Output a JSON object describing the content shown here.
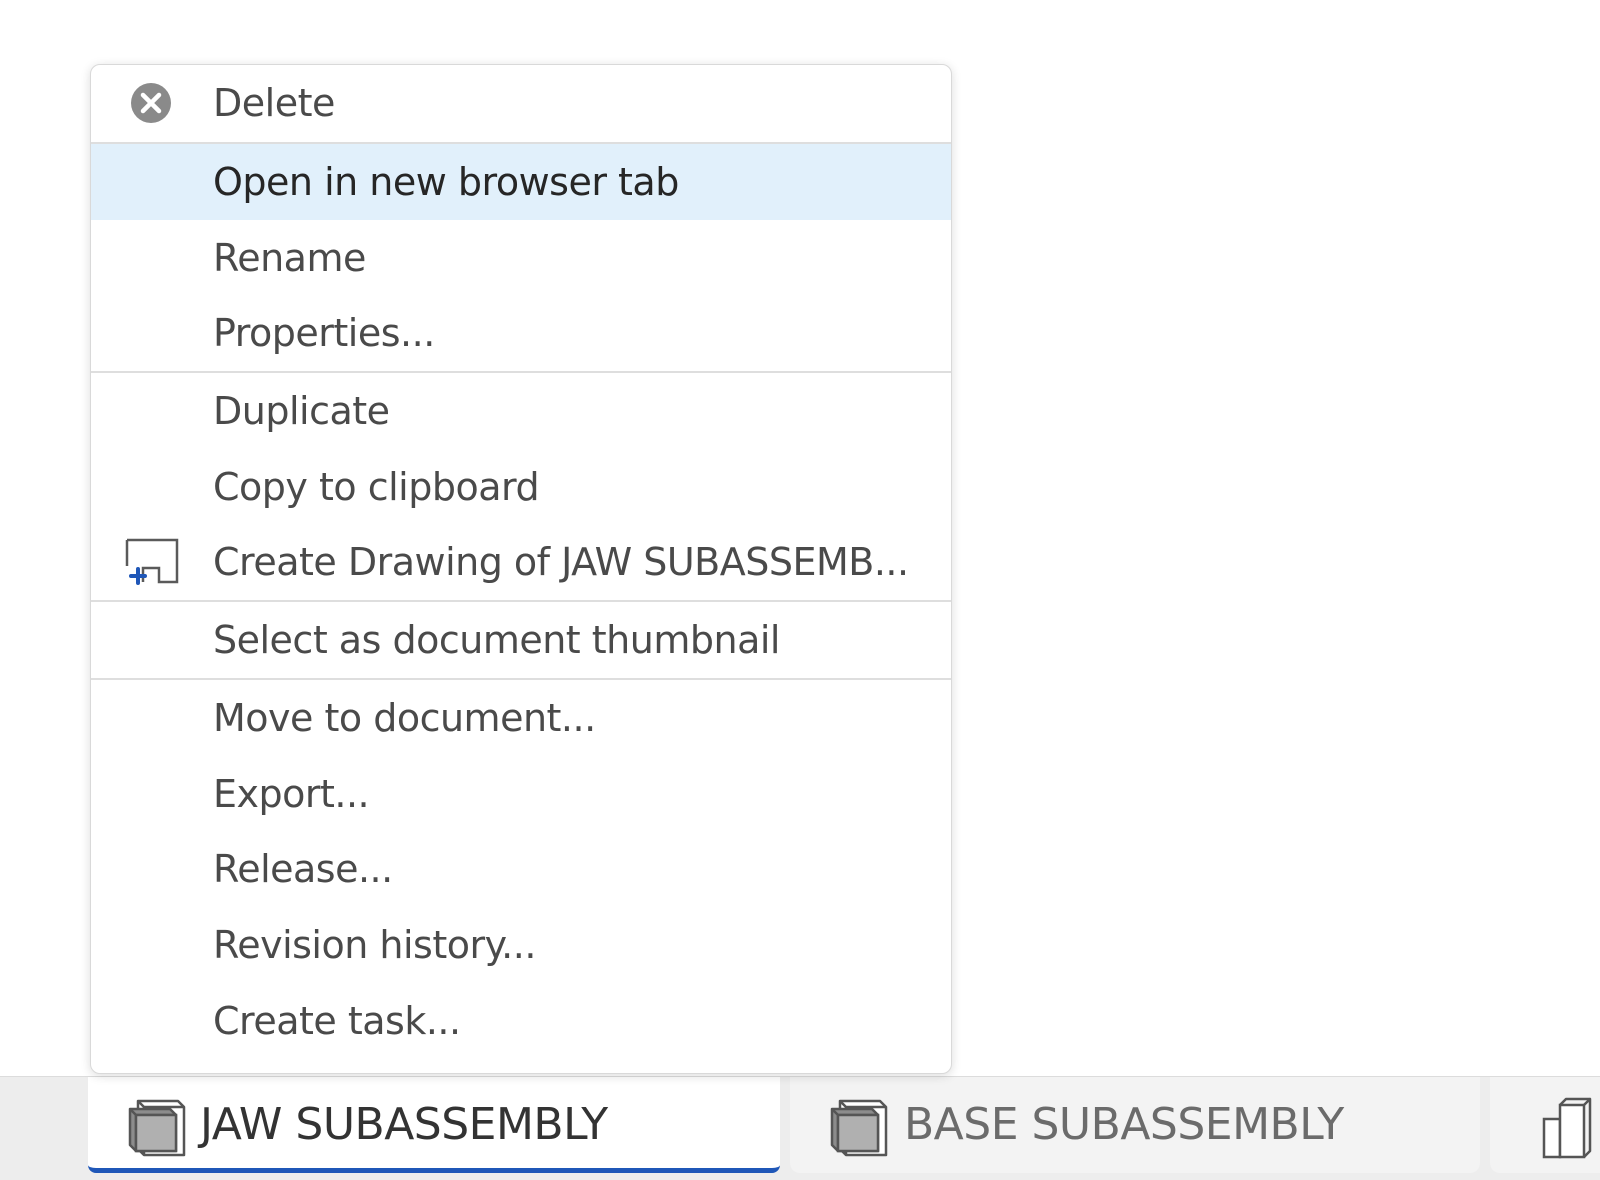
{
  "context_menu": {
    "items": [
      {
        "label": "Delete",
        "icon": "delete-circle-x-icon"
      },
      {
        "label": "Open in new browser tab"
      },
      {
        "label": "Rename"
      },
      {
        "label": "Properties..."
      },
      {
        "label": "Duplicate"
      },
      {
        "label": "Copy to clipboard"
      },
      {
        "label": "Create Drawing of JAW SUBASSEMB...",
        "icon": "create-drawing-icon"
      },
      {
        "label": "Select as document thumbnail"
      },
      {
        "label": "Move to document..."
      },
      {
        "label": "Export..."
      },
      {
        "label": "Release..."
      },
      {
        "label": "Revision history..."
      },
      {
        "label": "Create task..."
      }
    ],
    "highlighted": "Open in new browser tab"
  },
  "tabs": [
    {
      "label": "JAW SUBASSEMBLY",
      "icon": "assembly-icon",
      "active": true
    },
    {
      "label": "BASE SUBASSEMBLY",
      "icon": "assembly-icon",
      "active": false
    },
    {
      "label": "",
      "icon": "part-studio-icon",
      "active": false
    }
  ],
  "colors": {
    "highlight": "#e1f0fb",
    "active_tab_underline": "#1f57b8",
    "drawing_plus": "#1f57b8"
  }
}
